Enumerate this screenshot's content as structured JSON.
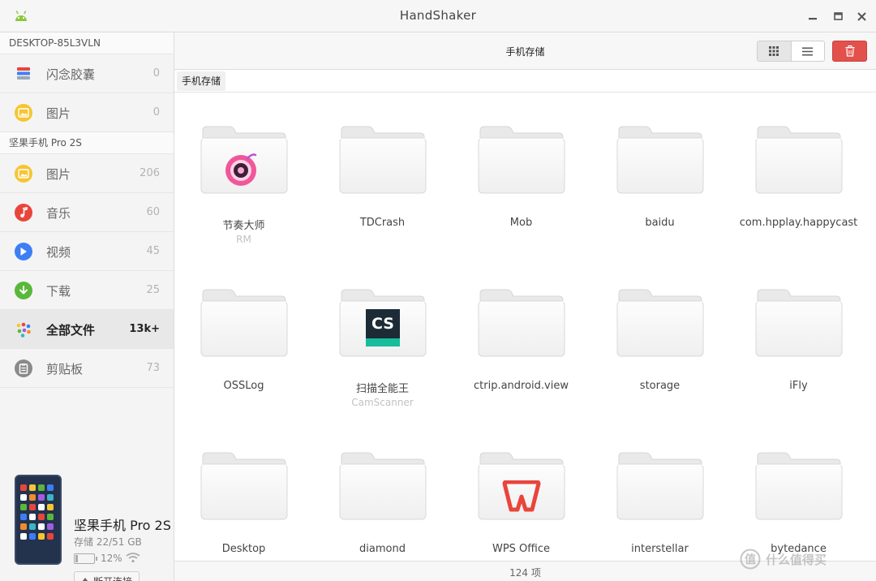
{
  "app": {
    "title": "HandShaker"
  },
  "sidebar": {
    "computer": {
      "name": "DESKTOP-85L3VLN",
      "items": [
        {
          "label": "闪念胶囊",
          "count": "0",
          "icon": "flash-capsule-icon",
          "color": "#e8eef6"
        },
        {
          "label": "图片",
          "count": "0",
          "icon": "photo-icon",
          "color": "#f7c531"
        }
      ]
    },
    "phone": {
      "name": "坚果手机 Pro 2S",
      "items": [
        {
          "label": "图片",
          "count": "206",
          "icon": "photo-icon",
          "color": "#f7c531"
        },
        {
          "label": "音乐",
          "count": "60",
          "icon": "music-icon",
          "color": "#e8453c"
        },
        {
          "label": "视频",
          "count": "45",
          "icon": "video-icon",
          "color": "#3d7ef5"
        },
        {
          "label": "下载",
          "count": "25",
          "icon": "download-icon",
          "color": "#59b83a"
        },
        {
          "label": "全部文件",
          "count": "13k+",
          "icon": "all-files-icon",
          "color": "#ffffff",
          "active": true
        },
        {
          "label": "剪贴板",
          "count": "73",
          "icon": "clipboard-icon",
          "color": "#8a8a8a"
        }
      ]
    }
  },
  "device": {
    "name": "坚果手机 Pro 2S",
    "storage": "存储 22/51 GB",
    "battery_percent_text": "12%",
    "battery_level": 0.12,
    "disconnect_label": "断开连接"
  },
  "toolbar": {
    "title": "手机存储",
    "view_mode": "grid"
  },
  "breadcrumb": {
    "items": [
      "手机存储"
    ]
  },
  "files": [
    {
      "name": "节奏大师",
      "sub": "RM",
      "badge": "rhythm-master-app-icon"
    },
    {
      "name": "TDCrash",
      "sub": ""
    },
    {
      "name": "Mob",
      "sub": ""
    },
    {
      "name": "baidu",
      "sub": ""
    },
    {
      "name": "com.hpplay.happycast",
      "sub": ""
    },
    {
      "name": "OSSLog",
      "sub": ""
    },
    {
      "name": "扫描全能王",
      "sub": "CamScanner",
      "badge": "camscanner-app-icon",
      "badge_text": "CS"
    },
    {
      "name": "ctrip.android.view",
      "sub": ""
    },
    {
      "name": "storage",
      "sub": ""
    },
    {
      "name": "iFly",
      "sub": ""
    },
    {
      "name": "Desktop",
      "sub": ""
    },
    {
      "name": "diamond",
      "sub": ""
    },
    {
      "name": "WPS Office",
      "sub": "",
      "badge": "wps-office-app-icon",
      "badge_text": "W"
    },
    {
      "name": "interstellar",
      "sub": ""
    },
    {
      "name": "bytedance",
      "sub": ""
    }
  ],
  "status": {
    "text": "124 项"
  },
  "watermark": {
    "text": "什么值得买"
  }
}
